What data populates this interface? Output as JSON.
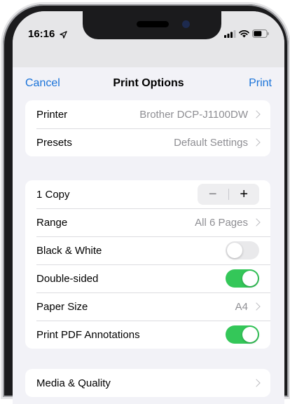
{
  "status_bar": {
    "time": "16:16"
  },
  "nav": {
    "cancel": "Cancel",
    "title": "Print Options",
    "print": "Print"
  },
  "printer_group": {
    "printer_label": "Printer",
    "printer_value": "Brother DCP-J1100DW",
    "presets_label": "Presets",
    "presets_value": "Default Settings"
  },
  "options_group": {
    "copies_label": "1 Copy",
    "stepper": {
      "minus": "−",
      "plus": "+"
    },
    "range_label": "Range",
    "range_value": "All 6 Pages",
    "bw_label": "Black & White",
    "bw_on": false,
    "double_label": "Double-sided",
    "double_on": true,
    "paper_label": "Paper Size",
    "paper_value": "A4",
    "annotations_label": "Print PDF Annotations",
    "annotations_on": true
  },
  "media_group": {
    "media_label": "Media & Quality"
  },
  "colors": {
    "accent": "#1a73d9",
    "toggle_on": "#34c759",
    "background": "#f2f2f7"
  }
}
